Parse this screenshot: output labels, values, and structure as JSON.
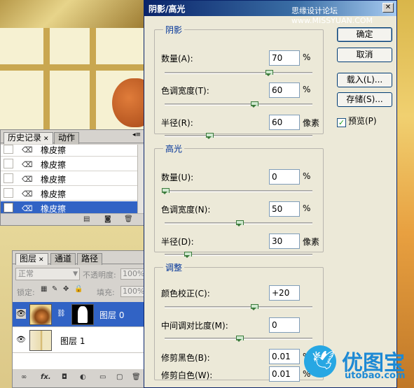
{
  "history_panel": {
    "tabs": [
      {
        "label": "历史记录"
      },
      {
        "label": "动作"
      }
    ],
    "items": [
      {
        "label": "橡皮擦"
      },
      {
        "label": "橡皮擦"
      },
      {
        "label": "橡皮擦"
      },
      {
        "label": "橡皮擦"
      },
      {
        "label": "橡皮擦",
        "selected": true
      }
    ]
  },
  "layers_panel": {
    "tabs": [
      {
        "label": "图层"
      },
      {
        "label": "通道"
      },
      {
        "label": "路径"
      }
    ],
    "blend_mode": "正常",
    "opacity_label": "不透明度:",
    "opacity_value": "100%",
    "lock_label": "锁定:",
    "fill_label": "填充:",
    "fill_value": "100%",
    "layers": [
      {
        "name": "图层 0",
        "selected": true,
        "has_mask": true
      },
      {
        "name": "图层 1",
        "selected": false,
        "has_mask": false
      }
    ]
  },
  "dialog": {
    "title": "阴影/高光",
    "watermark": "思缘设计论坛 www.MISSYUAN.COM",
    "shadows": {
      "title": "阴影",
      "amount_label": "数量(A):",
      "amount_value": "70",
      "amount_unit": "%",
      "amount_level": 70,
      "tonal_label": "色调宽度(T):",
      "tonal_value": "60",
      "tonal_unit": "%",
      "tonal_level": 60,
      "radius_label": "半径(R):",
      "radius_value": "60",
      "radius_unit": "像素",
      "radius_level": 0.3
    },
    "highlights": {
      "title": "高光",
      "amount_label": "数量(U):",
      "amount_value": "0",
      "amount_unit": "%",
      "amount_level": 0,
      "tonal_label": "色调宽度(N):",
      "tonal_value": "50",
      "tonal_unit": "%",
      "tonal_level": 50,
      "radius_label": "半径(D):",
      "radius_value": "30",
      "radius_unit": "像素",
      "radius_level": 0.15
    },
    "adjustments": {
      "title": "调整",
      "color_label": "颜色校正(C):",
      "color_value": "+20",
      "color_level": 0.6,
      "midtone_label": "中间调对比度(M):",
      "midtone_value": "0",
      "midtone_level": 0.5,
      "black_clip_label": "修剪黑色(B):",
      "black_clip_value": "0.01",
      "black_clip_unit": "%",
      "white_clip_label": "修剪白色(W):",
      "white_clip_value": "0.01",
      "white_clip_unit": "%"
    },
    "buttons": {
      "ok": "确定",
      "cancel": "取消",
      "load": "载入(L)...",
      "save": "存储(S)..."
    },
    "preview_label": "预览(P)",
    "preview_checked": true
  },
  "logo": {
    "cn": "优图宝",
    "en": "utobao.com"
  }
}
